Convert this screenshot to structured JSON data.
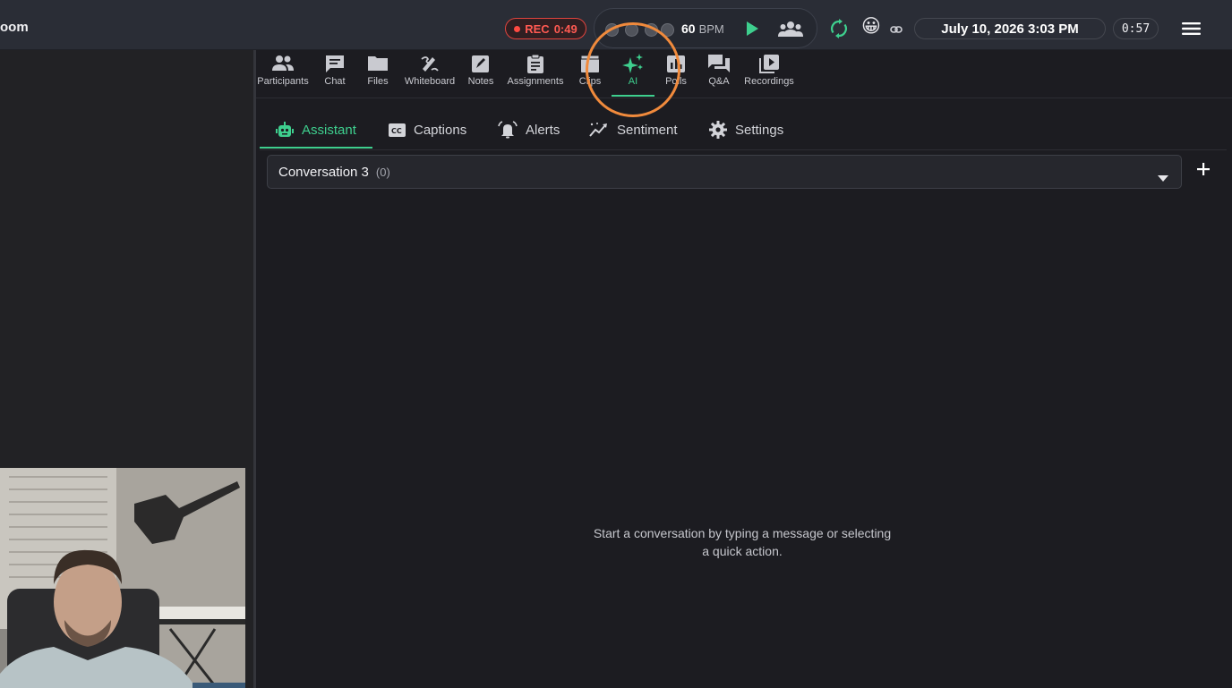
{
  "header": {
    "room_title": "oom",
    "recording": {
      "label": "REC",
      "elapsed": "0:49"
    },
    "metronome": {
      "bpm": "60",
      "bpm_unit": "BPM",
      "beats": 4,
      "play_icon": "play-icon",
      "group_icon": "group-icon"
    },
    "emoji": "😀",
    "datetime": "July 10, 2026 3:03 PM",
    "timer": "0:57",
    "icons": {
      "sync": "sync-icon",
      "link": "link-icon",
      "menu": "menu-icon"
    },
    "colors": {
      "rec": "#ff5a52",
      "accent": "#3ecf8e",
      "highlight_ring": "#f08a3c"
    }
  },
  "toolbar": {
    "tools": [
      {
        "label": "Participants",
        "icon": "people-icon"
      },
      {
        "label": "Chat",
        "icon": "chat-icon"
      },
      {
        "label": "Files",
        "icon": "folder-icon"
      },
      {
        "label": "Whiteboard",
        "icon": "draw-icon"
      },
      {
        "label": "Notes",
        "icon": "note-icon"
      },
      {
        "label": "Assignments",
        "icon": "clipboard-icon"
      },
      {
        "label": "Clips",
        "icon": "clapper-icon"
      },
      {
        "label": "AI",
        "icon": "sparkle-icon",
        "active": true
      },
      {
        "label": "Polls",
        "icon": "poll-icon"
      },
      {
        "label": "Q&A",
        "icon": "forum-icon"
      },
      {
        "label": "Recordings",
        "icon": "video-library-icon"
      }
    ]
  },
  "subtabs": [
    {
      "label": "Assistant",
      "icon": "robot-icon",
      "active": true
    },
    {
      "label": "Captions",
      "icon": "cc-icon"
    },
    {
      "label": "Alerts",
      "icon": "alarm-icon"
    },
    {
      "label": "Sentiment",
      "icon": "trend-icon"
    },
    {
      "label": "Settings",
      "icon": "gear-icon"
    }
  ],
  "conversation": {
    "selected": "Conversation 3",
    "count": "(0)",
    "empty_message": "Start a conversation by typing a message or selecting a quick action."
  }
}
